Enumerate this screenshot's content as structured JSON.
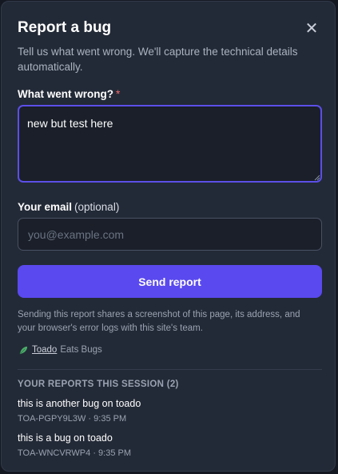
{
  "dialog": {
    "title": "Report a bug",
    "close_glyph": "✕",
    "subtitle": "Tell us what went wrong. We'll capture the technical details automatically."
  },
  "form": {
    "description": {
      "label": "What went wrong?",
      "required_marker": "*",
      "value": "new but test here"
    },
    "email": {
      "label": "Your email",
      "optional_hint": "(optional)",
      "value": "",
      "placeholder": "you@example.com"
    },
    "submit_label": "Send report",
    "disclaimer": "Sending this report shares a screenshot of this page, its address, and your browser's error logs with this site's team."
  },
  "brand": {
    "link_text": "Toado",
    "suffix": "Eats Bugs",
    "icon": "leaf-icon"
  },
  "reports": {
    "heading": "YOUR REPORTS THIS SESSION (2)",
    "items": [
      {
        "title": "this is another bug on toado",
        "meta": "TOA-PGPY9L3W · 9:35 PM"
      },
      {
        "title": "this is a bug on toado",
        "meta": "TOA-WNCVRWP4 · 9:35 PM"
      }
    ]
  },
  "colors": {
    "accent": "#5a49ee",
    "focus_border": "#5b4fe8",
    "required": "#ef6b6b",
    "panel_bg": "#232a37"
  }
}
